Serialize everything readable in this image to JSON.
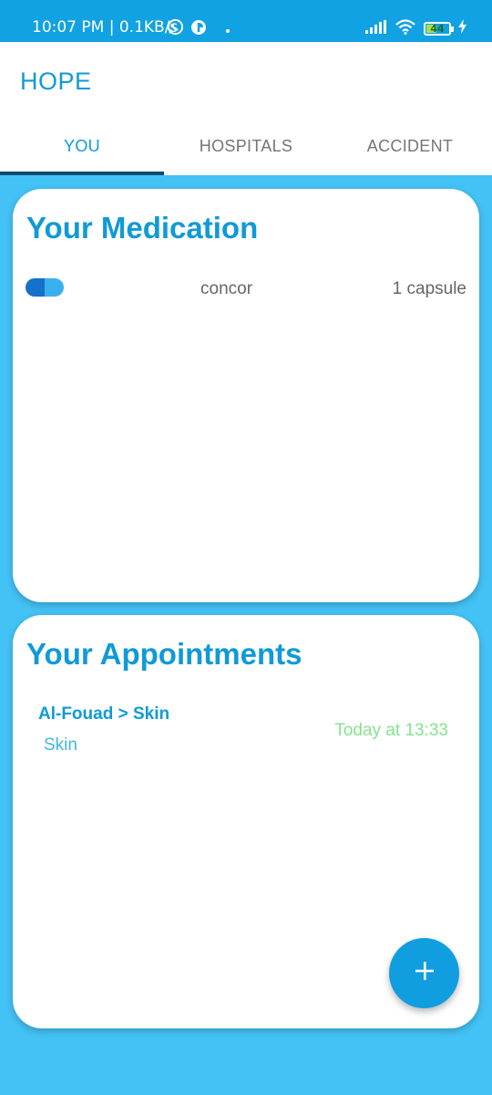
{
  "status_bar": {
    "time": "10:07 PM | 0.1KB/s",
    "battery": "44",
    "battery_level": 0.44,
    "left_icons": [
      "whatsapp-icon",
      "app-notification-icon",
      "dot-icon"
    ],
    "right_icons": [
      "signal-icon",
      "wifi-icon",
      "battery-icon",
      "charging-icon"
    ]
  },
  "app": {
    "title": "HOPE"
  },
  "tabs": [
    {
      "label": "YOU",
      "active": true
    },
    {
      "label": "HOSPITALS",
      "active": false
    },
    {
      "label": "ACCIDENT",
      "active": false
    }
  ],
  "medication": {
    "title": "Your Medication",
    "items": [
      {
        "name": "concor",
        "dose": "1 capsule",
        "icon": "pill-icon"
      }
    ]
  },
  "appointments": {
    "title": "Your Appointments",
    "items": [
      {
        "place": "Al-Fouad > Skin",
        "department": "Skin",
        "time": "Today at 13:33"
      }
    ]
  },
  "fab": {
    "icon": "plus-icon"
  },
  "colors": {
    "status_bar": "#10a2e2",
    "background": "#43c2f5",
    "accent": "#109ad7",
    "tab_indicator": "#0f4a6f",
    "appointment_time": "#86e38f",
    "pill_dark": "#1671c9",
    "pill_light": "#3bb0ef"
  }
}
